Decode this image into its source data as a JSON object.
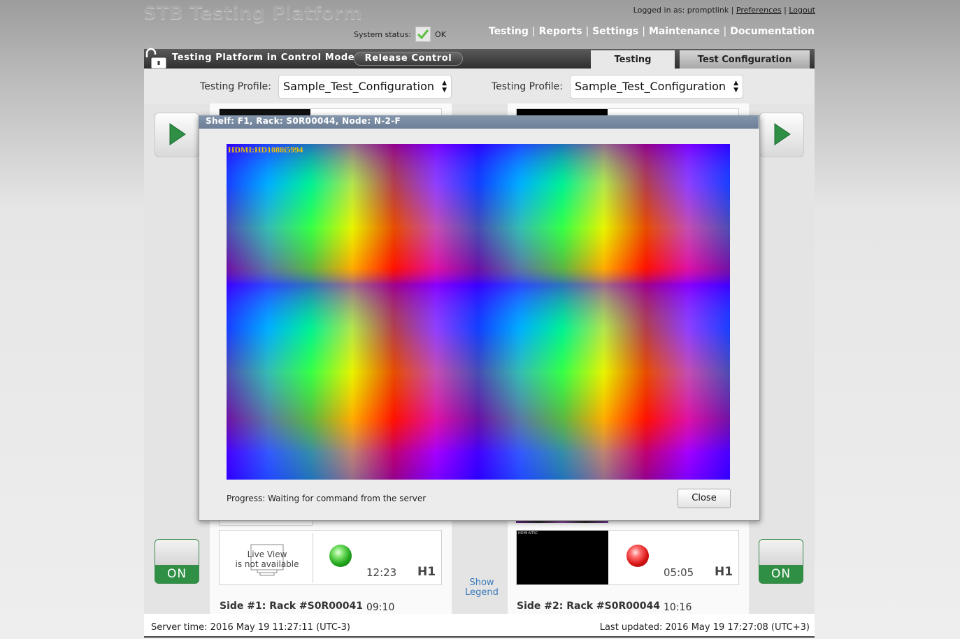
{
  "header": {
    "app_title": "STB Testing Platform",
    "logged_in_label": "Logged in as:",
    "username": "promptlink",
    "preferences_link": "Preferences",
    "logout_link": "Logout",
    "system_status_label": "System status:",
    "system_status_value": "OK",
    "nav": [
      "Testing",
      "Reports",
      "Settings",
      "Maintenance",
      "Documentation"
    ]
  },
  "control_bar": {
    "title": "Testing Platform in Control Mode",
    "release_button": "Release Control",
    "tabs": [
      "Testing",
      "Test Configuration"
    ]
  },
  "profiles": {
    "left_label": "Testing Profile:",
    "left_value": "Sample_Test_Configuration",
    "right_label": "Testing Profile:",
    "right_value": "Sample_Test_Configuration"
  },
  "side1": {
    "label": "Side #1: Rack #S0R00041",
    "time": "09:10",
    "card": {
      "live_view_line1": "Live View",
      "live_view_line2": "is not available",
      "led": "green",
      "time": "12:23",
      "slot": "H1"
    },
    "on_label": "ON"
  },
  "side2": {
    "label": "Side #2: Rack #S0R00044",
    "time": "10:16",
    "card": {
      "thumb_label": "HDMI:NTSC",
      "led": "red",
      "time": "05:05",
      "slot": "H1"
    },
    "on_label": "ON"
  },
  "show_legend": {
    "line1": "Show",
    "line2": "Legend"
  },
  "footer": {
    "server_time": "Server time: 2016 May 19 11:27:11 (UTC-3)",
    "last_updated": "Last updated: 2016 May 19 17:27:08 (UTC+3)"
  },
  "modal": {
    "title": "Shelf: F1, Rack: S0R00044, Node: N-2-F",
    "video_label": "HDMI:HD1080i5994",
    "progress": "Progress: Waiting for command from the server",
    "close_button": "Close"
  },
  "colors": {
    "accent_green": "#2f8f45",
    "modal_header": "#7a8ca2",
    "link_blue": "#3a7ab8"
  }
}
